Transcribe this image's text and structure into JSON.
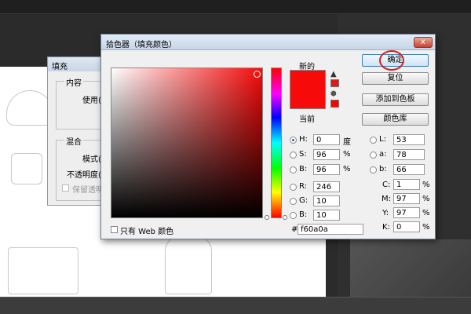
{
  "picker": {
    "title": "拾色器（填充颜色）",
    "close_label": "x",
    "new_label": "新的",
    "current_label": "当前",
    "new_color": "#f60a0a",
    "current_color": "#f60a0a",
    "ok_label": "确定",
    "reset_label": "复位",
    "add_swatch_label": "添加到色板",
    "library_label": "颜色库",
    "web_only_label": "只有 Web 颜色",
    "hsb": [
      {
        "label": "H:",
        "value": "0",
        "unit": "度",
        "selected": true
      },
      {
        "label": "S:",
        "value": "96",
        "unit": "%",
        "selected": false
      },
      {
        "label": "B:",
        "value": "96",
        "unit": "%",
        "selected": false
      }
    ],
    "rgb": [
      {
        "label": "R:",
        "value": "246"
      },
      {
        "label": "G:",
        "value": "10"
      },
      {
        "label": "B:",
        "value": "10"
      }
    ],
    "lab": [
      {
        "label": "L:",
        "value": "53"
      },
      {
        "label": "a:",
        "value": "78"
      },
      {
        "label": "b:",
        "value": "66"
      }
    ],
    "cmyk": [
      {
        "label": "C:",
        "value": "1",
        "unit": "%"
      },
      {
        "label": "M:",
        "value": "97",
        "unit": "%"
      },
      {
        "label": "Y:",
        "value": "97",
        "unit": "%"
      },
      {
        "label": "K:",
        "value": "0",
        "unit": "%"
      }
    ],
    "hex_label": "#",
    "hex_value": "f60a0a"
  },
  "fill_dialog": {
    "title": "填充",
    "content_group": "内容",
    "use_label": "使用(U",
    "blend_group": "混合",
    "mode_label": "模式(M",
    "opacity_label": "不透明度(O",
    "preserve_label": "保留透明区"
  }
}
